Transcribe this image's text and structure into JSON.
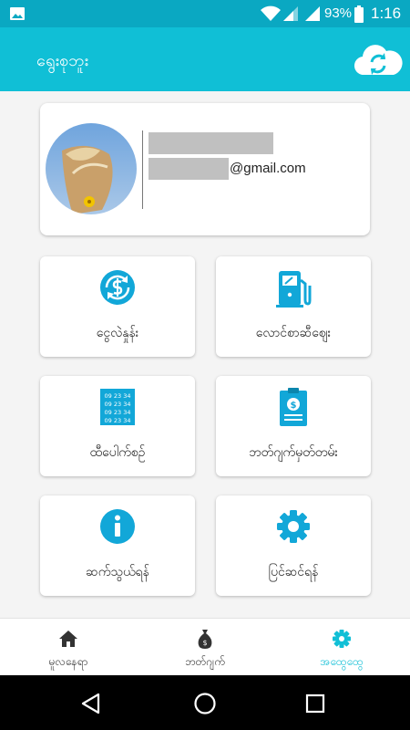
{
  "status_bar": {
    "battery": "93%",
    "time": "1:16"
  },
  "app_bar": {
    "title": "ရွေးစုဘူး",
    "sync_icon": "cloud-sync-icon"
  },
  "profile": {
    "email_suffix": "@gmail.com"
  },
  "menu": [
    {
      "label": "ငွေလဲနှုန်း",
      "icon": "currency-exchange-icon"
    },
    {
      "label": "လောင်စာဆီဈေး",
      "icon": "fuel-pump-icon"
    },
    {
      "label": "ထီပေါက်စဉ်",
      "icon": "lottery-ticket-icon",
      "ticket_lines": [
        "09 23 34",
        "09 23 34",
        "09 23 34",
        "09 23 34"
      ]
    },
    {
      "label": "ဘတ်ဂျက်မှတ်တမ်း",
      "icon": "budget-clipboard-icon"
    },
    {
      "label": "ဆက်သွယ်ရန်",
      "icon": "info-icon"
    },
    {
      "label": "ပြင်ဆင်ရန်",
      "icon": "settings-gear-icon"
    }
  ],
  "bottom_nav": [
    {
      "label": "မူလနေရာ",
      "icon": "home-icon"
    },
    {
      "label": "ဘတ်ဂျက်",
      "icon": "money-bag-icon"
    },
    {
      "label": "အထွေထွေ",
      "icon": "gear-icon",
      "active": true
    }
  ],
  "colors": {
    "primary": "#10bfd6",
    "status_bar": "#0aa8c2",
    "icon_blue": "#12a7d8"
  }
}
